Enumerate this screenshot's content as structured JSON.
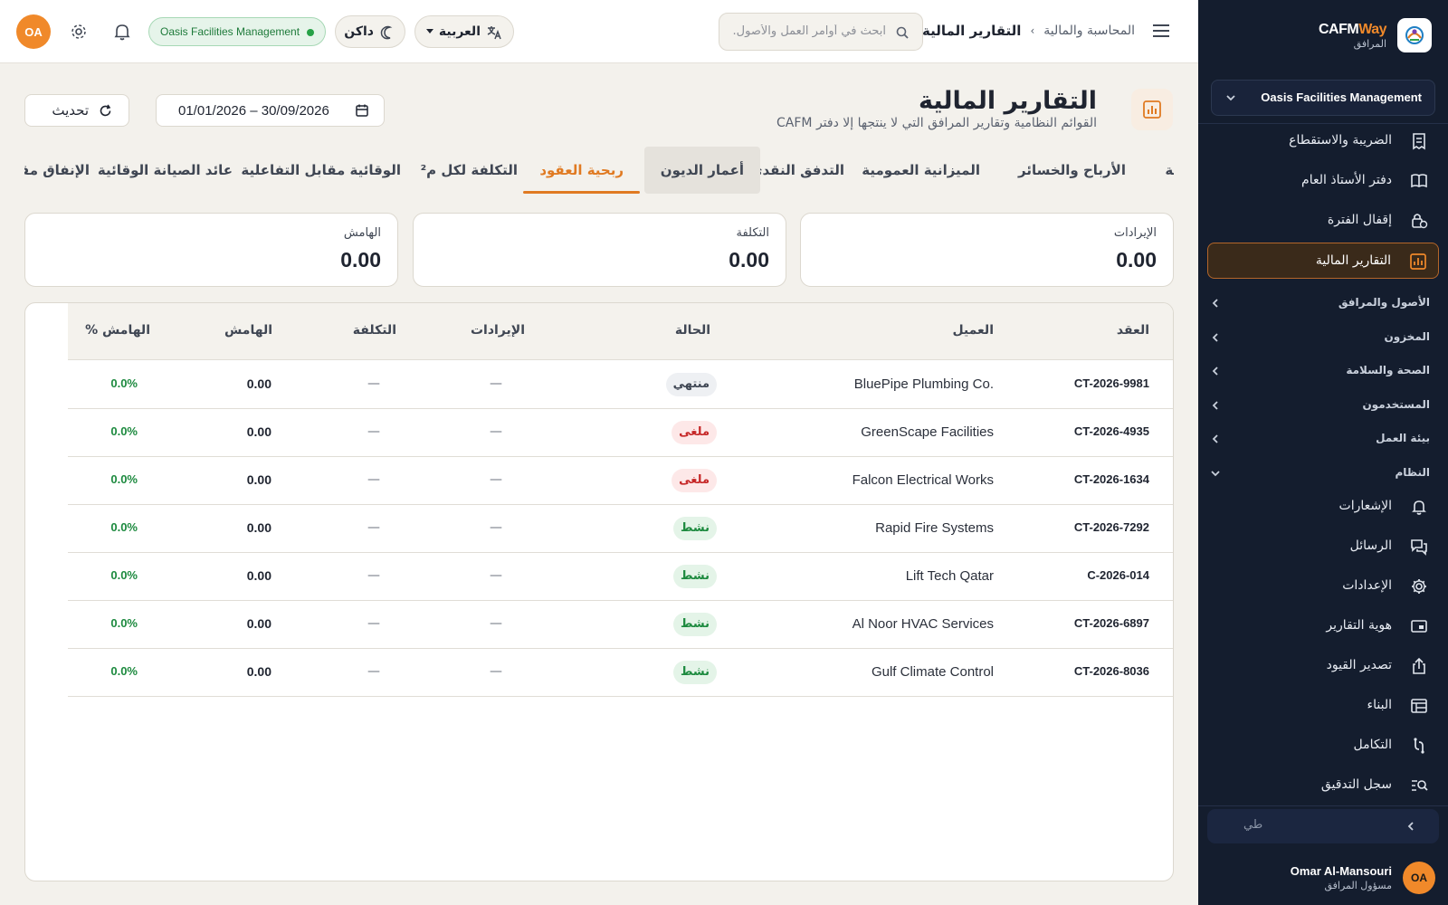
{
  "brand": {
    "name_a": "CAFM",
    "name_b": "Way",
    "sub": "المرافق"
  },
  "sidebar": {
    "org": "Oasis Facilities Management",
    "items_top": [
      {
        "label": "الضريبة والاستقطاع",
        "icon": "receipt-icon"
      },
      {
        "label": "دفتر الأستاذ العام",
        "icon": "book-icon"
      },
      {
        "label": "إقفال الفترة",
        "icon": "lock-clock-icon"
      },
      {
        "label": "التقارير المالية",
        "icon": "chart-report-icon",
        "active": true
      }
    ],
    "groups": [
      {
        "label": "الأصول والمرافق"
      },
      {
        "label": "المخزون"
      },
      {
        "label": "الصحة والسلامة"
      },
      {
        "label": "المستخدمون"
      },
      {
        "label": "بيئة العمل"
      },
      {
        "label": "النظام",
        "open": true
      }
    ],
    "items_system": [
      {
        "label": "الإشعارات",
        "icon": "bell-icon"
      },
      {
        "label": "الرسائل",
        "icon": "messages-icon"
      },
      {
        "label": "الإعدادات",
        "icon": "gear-icon"
      },
      {
        "label": "هوية التقارير",
        "icon": "branding-icon"
      },
      {
        "label": "تصدير القيود",
        "icon": "export-icon"
      },
      {
        "label": "البناء",
        "icon": "builder-icon"
      },
      {
        "label": "التكامل",
        "icon": "integration-icon"
      },
      {
        "label": "سجل التدقيق",
        "icon": "audit-search-icon"
      }
    ],
    "collapse_placeholder": "طي",
    "user": {
      "initials": "OA",
      "name": "Omar Al-Mansouri",
      "role": "مسؤول المرافق"
    }
  },
  "topbar": {
    "breadcrumb": [
      "المحاسبة والمالية",
      "التقارير المالية"
    ],
    "search_placeholder": "ابحث في أوامر العمل والأصول...",
    "language": "العربية",
    "theme": "داكن",
    "org_pill": "Oasis Facilities Management",
    "avatar": "OA"
  },
  "page": {
    "title": "التقارير المالية",
    "subtitle": "القوائم النظامية وتقارير المرافق التي لا ينتجها إلا دفتر CAFM",
    "date_range": "01/01/2026 – 30/09/2026",
    "refresh": "تحديث"
  },
  "tabs": [
    {
      "label": "ميزان المراجعة"
    },
    {
      "label": "الأرباح والخسائر"
    },
    {
      "label": "الميزانية العمومية"
    },
    {
      "label": "التدفق النقدي"
    },
    {
      "label": "أعمار الديون",
      "hover": true
    },
    {
      "label": "ربحية العقود",
      "active": true
    },
    {
      "label": "التكلفة لكل م²"
    },
    {
      "label": "الوقائية مقابل التفاعلية"
    },
    {
      "label": "عائد الصيانة الوقائية"
    },
    {
      "label": "الإنفاق مقابل الميزانية"
    }
  ],
  "kpis": [
    {
      "label": "الإيرادات",
      "value": "0.00"
    },
    {
      "label": "التكلفة",
      "value": "0.00"
    },
    {
      "label": "الهامش",
      "value": "0.00"
    }
  ],
  "table": {
    "columns": [
      "العقد",
      "العميل",
      "الحالة",
      "الإيرادات",
      "التكلفة",
      "الهامش",
      "الهامش %"
    ],
    "rows": [
      {
        "contract": "CT-2026-9981",
        "client": "BluePipe Plumbing Co.",
        "status": "منتهي",
        "status_type": "ended",
        "revenue": "—",
        "cost": "—",
        "margin": "0.00",
        "margin_pct": "0.0%"
      },
      {
        "contract": "CT-2026-4935",
        "client": "GreenScape Facilities",
        "status": "ملغى",
        "status_type": "cancel",
        "revenue": "—",
        "cost": "—",
        "margin": "0.00",
        "margin_pct": "0.0%"
      },
      {
        "contract": "CT-2026-1634",
        "client": "Falcon Electrical Works",
        "status": "ملغى",
        "status_type": "cancel",
        "revenue": "—",
        "cost": "—",
        "margin": "0.00",
        "margin_pct": "0.0%"
      },
      {
        "contract": "CT-2026-7292",
        "client": "Rapid Fire Systems",
        "status": "نشط",
        "status_type": "active",
        "revenue": "—",
        "cost": "—",
        "margin": "0.00",
        "margin_pct": "0.0%"
      },
      {
        "contract": "C-2026-014",
        "client": "Lift Tech Qatar",
        "status": "نشط",
        "status_type": "active",
        "revenue": "—",
        "cost": "—",
        "margin": "0.00",
        "margin_pct": "0.0%"
      },
      {
        "contract": "CT-2026-6897",
        "client": "Al Noor HVAC Services",
        "status": "نشط",
        "status_type": "active",
        "revenue": "—",
        "cost": "—",
        "margin": "0.00",
        "margin_pct": "0.0%"
      },
      {
        "contract": "CT-2026-8036",
        "client": "Gulf Climate Control",
        "status": "نشط",
        "status_type": "active",
        "revenue": "—",
        "cost": "—",
        "margin": "0.00",
        "margin_pct": "0.0%"
      }
    ]
  }
}
